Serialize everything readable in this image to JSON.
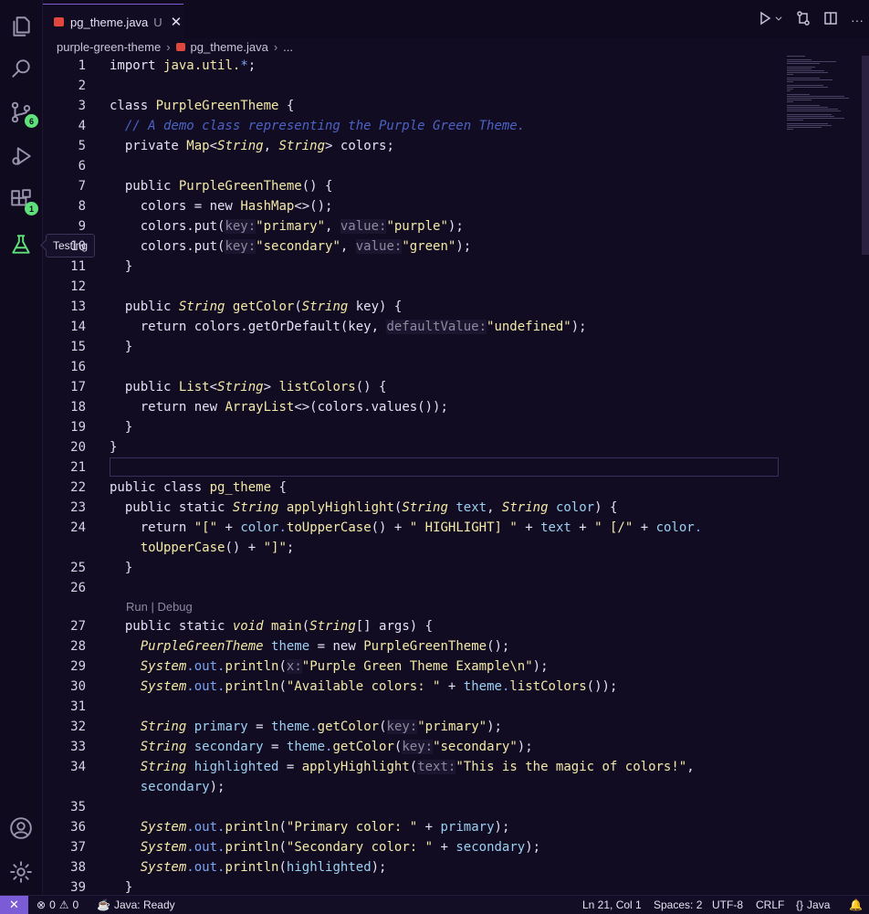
{
  "tab": {
    "filename": "pg_theme.java",
    "state": "U",
    "close": "✕"
  },
  "breadcrumb": {
    "folder": "purple-green-theme",
    "file": "pg_theme.java",
    "more": "..."
  },
  "activity": {
    "scm_badge": "6",
    "extensions_badge": "1",
    "tooltip": "Testing"
  },
  "editor": {
    "codelens": "Run | Debug",
    "lines": [
      {
        "n": "1",
        "tokens": [
          [
            "kw",
            "import "
          ],
          [
            "cls",
            "java.util."
          ],
          [
            "blue",
            "*"
          ],
          [
            "",
            "; "
          ]
        ]
      },
      {
        "n": "2",
        "tokens": []
      },
      {
        "n": "3",
        "tokens": [
          [
            "kw",
            "class "
          ],
          [
            "cls",
            "PurpleGreenTheme"
          ],
          [
            "",
            " {"
          ]
        ]
      },
      {
        "n": "4",
        "tokens": [
          [
            "",
            "  "
          ],
          [
            "cmt",
            "// A demo class representing the Purple Green Theme."
          ]
        ]
      },
      {
        "n": "5",
        "tokens": [
          [
            "",
            "  private "
          ],
          [
            "cls",
            "Map"
          ],
          [
            "",
            "<"
          ],
          [
            "cls ital",
            "String"
          ],
          [
            "",
            ", "
          ],
          [
            "cls ital",
            "String"
          ],
          [
            "",
            "> colors;"
          ]
        ]
      },
      {
        "n": "6",
        "tokens": []
      },
      {
        "n": "7",
        "tokens": [
          [
            "",
            "  public "
          ],
          [
            "fn",
            "PurpleGreenTheme"
          ],
          [
            "",
            "() {"
          ]
        ]
      },
      {
        "n": "8",
        "tokens": [
          [
            "",
            "    colors = "
          ],
          [
            "",
            "new"
          ],
          [
            "",
            " "
          ],
          [
            "cls",
            "HashMap"
          ],
          [
            "",
            "<>();"
          ]
        ]
      },
      {
        "n": "9",
        "tokens": [
          [
            "",
            "    colors.put("
          ],
          [
            "hint",
            "key:"
          ],
          [
            "str",
            "\"primary\""
          ],
          [
            "",
            ", "
          ],
          [
            "hint",
            "value:"
          ],
          [
            "str",
            "\"purple\""
          ],
          [
            "",
            ");"
          ]
        ]
      },
      {
        "n": "10",
        "tokens": [
          [
            "",
            "    colors.put("
          ],
          [
            "hint",
            "key:"
          ],
          [
            "str",
            "\"secondary\""
          ],
          [
            "",
            ", "
          ],
          [
            "hint",
            "value:"
          ],
          [
            "str",
            "\"green\""
          ],
          [
            "",
            ");"
          ]
        ]
      },
      {
        "n": "11",
        "tokens": [
          [
            "",
            "  }"
          ]
        ]
      },
      {
        "n": "12",
        "tokens": []
      },
      {
        "n": "13",
        "tokens": [
          [
            "",
            "  public "
          ],
          [
            "cls ital",
            "String"
          ],
          [
            "",
            " "
          ],
          [
            "fn",
            "getColor"
          ],
          [
            "",
            "("
          ],
          [
            "cls ital",
            "String"
          ],
          [
            "",
            " key) {"
          ]
        ]
      },
      {
        "n": "14",
        "tokens": [
          [
            "",
            "    return colors.getOrDefault(key, "
          ],
          [
            "hint",
            "defaultValue:"
          ],
          [
            "str",
            "\"undefined\""
          ],
          [
            "",
            ");"
          ]
        ]
      },
      {
        "n": "15",
        "tokens": [
          [
            "",
            "  }"
          ]
        ]
      },
      {
        "n": "16",
        "tokens": []
      },
      {
        "n": "17",
        "tokens": [
          [
            "",
            "  public "
          ],
          [
            "cls",
            "List"
          ],
          [
            "",
            "<"
          ],
          [
            "cls ital",
            "String"
          ],
          [
            "",
            "> "
          ],
          [
            "fn",
            "listColors"
          ],
          [
            "",
            "() {"
          ]
        ]
      },
      {
        "n": "18",
        "tokens": [
          [
            "",
            "    return "
          ],
          [
            "",
            "new"
          ],
          [
            "",
            " "
          ],
          [
            "cls",
            "ArrayList"
          ],
          [
            "",
            "<>(colors.values());"
          ]
        ]
      },
      {
        "n": "19",
        "tokens": [
          [
            "",
            "  }"
          ]
        ]
      },
      {
        "n": "20",
        "tokens": [
          [
            "",
            "}"
          ]
        ]
      },
      {
        "n": "21",
        "tokens": []
      },
      {
        "n": "22",
        "tokens": [
          [
            "",
            "public class "
          ],
          [
            "cls",
            "pg_theme"
          ],
          [
            "",
            " {"
          ]
        ]
      },
      {
        "n": "23",
        "tokens": [
          [
            "",
            "  public static "
          ],
          [
            "cls ital",
            "String"
          ],
          [
            "",
            " "
          ],
          [
            "fn",
            "applyHighlight"
          ],
          [
            "",
            "("
          ],
          [
            "cls ital",
            "String"
          ],
          [
            "",
            " "
          ],
          [
            "var",
            "text"
          ],
          [
            "",
            ", "
          ],
          [
            "cls ital",
            "String"
          ],
          [
            "",
            " "
          ],
          [
            "var",
            "color"
          ],
          [
            "",
            ") {"
          ]
        ]
      },
      {
        "n": "24",
        "tokens": [
          [
            "",
            "    return "
          ],
          [
            "str",
            "\"[\""
          ],
          [
            "",
            " + "
          ],
          [
            "var",
            "color"
          ],
          [
            "blue",
            "."
          ],
          [
            "fn",
            "toUpperCase"
          ],
          [
            "",
            "() + "
          ],
          [
            "str",
            "\" HIGHLIGHT] \""
          ],
          [
            "",
            " + "
          ],
          [
            "var",
            "text"
          ],
          [
            "",
            " + "
          ],
          [
            "str",
            "\" [/\""
          ],
          [
            "",
            " + "
          ],
          [
            "var",
            "color"
          ],
          [
            "blue",
            "."
          ]
        ]
      },
      {
        "n": "",
        "tokens": [
          [
            "",
            "    "
          ],
          [
            "fn",
            "toUpperCase"
          ],
          [
            "",
            "() + "
          ],
          [
            "str",
            "\"]\""
          ],
          [
            "",
            ";"
          ]
        ]
      },
      {
        "n": "25",
        "tokens": [
          [
            "",
            "  }"
          ]
        ]
      },
      {
        "n": "26",
        "tokens": []
      },
      {
        "n": "27",
        "tokens": [
          [
            "",
            "  public static "
          ],
          [
            "cls ital",
            "void"
          ],
          [
            "",
            " "
          ],
          [
            "fn",
            "main"
          ],
          [
            "",
            "("
          ],
          [
            "cls ital",
            "String"
          ],
          [
            "",
            "[] args) {"
          ]
        ]
      },
      {
        "n": "28",
        "tokens": [
          [
            "",
            "    "
          ],
          [
            "cls ital",
            "PurpleGreenTheme"
          ],
          [
            "",
            " "
          ],
          [
            "var",
            "theme"
          ],
          [
            "",
            " = "
          ],
          [
            "",
            "new"
          ],
          [
            "",
            " "
          ],
          [
            "fn",
            "PurpleGreenTheme"
          ],
          [
            "",
            "();"
          ]
        ]
      },
      {
        "n": "29",
        "tokens": [
          [
            "",
            "    "
          ],
          [
            "cls ital",
            "System"
          ],
          [
            "blue",
            ".out."
          ],
          [
            "fn",
            "println"
          ],
          [
            "",
            "("
          ],
          [
            "hint",
            "x:"
          ],
          [
            "str",
            "\"Purple Green Theme Example\\n\""
          ],
          [
            "",
            ");"
          ]
        ]
      },
      {
        "n": "30",
        "tokens": [
          [
            "",
            "    "
          ],
          [
            "cls ital",
            "System"
          ],
          [
            "blue",
            ".out."
          ],
          [
            "fn",
            "println"
          ],
          [
            "",
            "("
          ],
          [
            "str",
            "\"Available colors: \""
          ],
          [
            "",
            " + "
          ],
          [
            "var",
            "theme"
          ],
          [
            "blue",
            "."
          ],
          [
            "fn",
            "listColors"
          ],
          [
            "",
            "());"
          ]
        ]
      },
      {
        "n": "31",
        "tokens": []
      },
      {
        "n": "32",
        "tokens": [
          [
            "",
            "    "
          ],
          [
            "cls ital",
            "String"
          ],
          [
            "",
            " "
          ],
          [
            "var",
            "primary"
          ],
          [
            "",
            " = "
          ],
          [
            "var",
            "theme"
          ],
          [
            "blue",
            "."
          ],
          [
            "fn",
            "getColor"
          ],
          [
            "",
            "("
          ],
          [
            "hint",
            "key:"
          ],
          [
            "str",
            "\"primary\""
          ],
          [
            "",
            ");"
          ]
        ]
      },
      {
        "n": "33",
        "tokens": [
          [
            "",
            "    "
          ],
          [
            "cls ital",
            "String"
          ],
          [
            "",
            " "
          ],
          [
            "var",
            "secondary"
          ],
          [
            "",
            " = "
          ],
          [
            "var",
            "theme"
          ],
          [
            "blue",
            "."
          ],
          [
            "fn",
            "getColor"
          ],
          [
            "",
            "("
          ],
          [
            "hint",
            "key:"
          ],
          [
            "str",
            "\"secondary\""
          ],
          [
            "",
            ");"
          ]
        ]
      },
      {
        "n": "34",
        "tokens": [
          [
            "",
            "    "
          ],
          [
            "cls ital",
            "String"
          ],
          [
            "",
            " "
          ],
          [
            "var",
            "highlighted"
          ],
          [
            "",
            " = "
          ],
          [
            "fn",
            "applyHighlight"
          ],
          [
            "",
            "("
          ],
          [
            "hint",
            "text:"
          ],
          [
            "str",
            "\"This is the magic of colors!\""
          ],
          [
            "",
            ","
          ]
        ]
      },
      {
        "n": "",
        "tokens": [
          [
            "",
            "    "
          ],
          [
            "var",
            "secondary"
          ],
          [
            "",
            ");"
          ]
        ]
      },
      {
        "n": "35",
        "tokens": []
      },
      {
        "n": "36",
        "tokens": [
          [
            "",
            "    "
          ],
          [
            "cls ital",
            "System"
          ],
          [
            "blue",
            ".out."
          ],
          [
            "fn",
            "println"
          ],
          [
            "",
            "("
          ],
          [
            "str",
            "\"Primary color: \""
          ],
          [
            "",
            " + "
          ],
          [
            "var",
            "primary"
          ],
          [
            "",
            ");"
          ]
        ]
      },
      {
        "n": "37",
        "tokens": [
          [
            "",
            "    "
          ],
          [
            "cls ital",
            "System"
          ],
          [
            "blue",
            ".out."
          ],
          [
            "fn",
            "println"
          ],
          [
            "",
            "("
          ],
          [
            "str",
            "\"Secondary color: \""
          ],
          [
            "",
            " + "
          ],
          [
            "var",
            "secondary"
          ],
          [
            "",
            ");"
          ]
        ]
      },
      {
        "n": "38",
        "tokens": [
          [
            "",
            "    "
          ],
          [
            "cls ital",
            "System"
          ],
          [
            "blue",
            ".out."
          ],
          [
            "fn",
            "println"
          ],
          [
            "",
            "("
          ],
          [
            "var",
            "highlighted"
          ],
          [
            "",
            ");"
          ]
        ]
      },
      {
        "n": "39",
        "tokens": [
          [
            "",
            "  }"
          ]
        ]
      }
    ]
  },
  "status": {
    "remote": "✕",
    "errors": "0",
    "warnings": "0",
    "java_status": "Java: Ready",
    "position": "Ln 21, Col 1",
    "spaces": "Spaces: 2",
    "encoding": "UTF-8",
    "eol": "CRLF",
    "language": "Java"
  },
  "colors": {
    "accent": "#7c5cd6",
    "green": "#5ee07a",
    "background": "#120c22"
  }
}
